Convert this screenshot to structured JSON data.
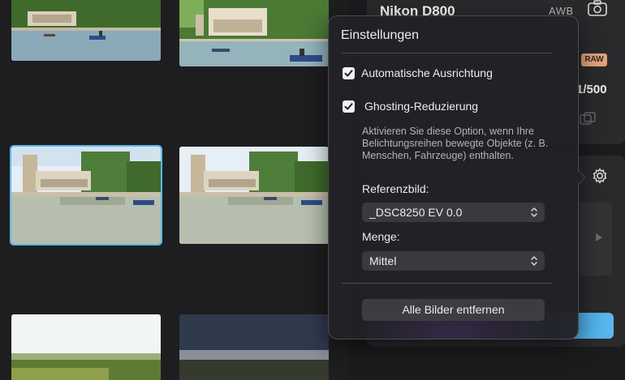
{
  "camera": {
    "name": "Nikon D800",
    "white_balance": "AWB",
    "raw_badge": "RAW",
    "shutter": "1/500",
    "camera_icon": "camera-icon",
    "copy_icon": "copy-icon"
  },
  "settings_button": {
    "icon": "gear-icon"
  },
  "popover": {
    "title": "Einstellungen",
    "auto_align": {
      "label": "Automatische Ausrichtung",
      "checked": true
    },
    "ghosting": {
      "label": "Ghosting-Reduzierung",
      "checked": true
    },
    "help_text": "Aktivieren Sie diese Option, wenn Ihre Belichtungsreihen bewegte Objekte (z. B. Menschen, Fahrzeuge) enthalten.",
    "reference_label": "Referenzbild:",
    "reference_value": "_DSC8250 EV 0.0",
    "amount_label": "Menge:",
    "amount_value": "Mittel",
    "remove_all_label": "Alle Bilder entfernen"
  },
  "thumbnails": [
    {
      "scene": "park-lake",
      "selected": false
    },
    {
      "scene": "park-lake",
      "selected": false
    },
    {
      "scene": "park-lake",
      "selected": true
    },
    {
      "scene": "park-lake",
      "selected": false
    },
    {
      "scene": "landscape-day",
      "selected": false
    },
    {
      "scene": "landscape-dusk",
      "selected": false
    }
  ],
  "colors": {
    "accent": "#5fb8ec",
    "raw_badge": "#e3a27a",
    "popover_bg": "#222126"
  }
}
